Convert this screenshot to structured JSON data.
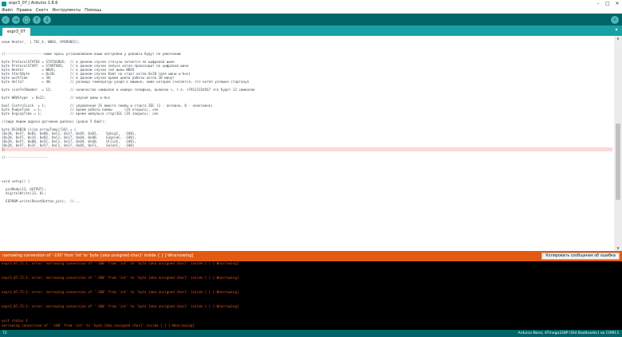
{
  "window": {
    "title": "espr3_07 | Arduino 1.8.6"
  },
  "menu": [
    "Файл",
    "Правка",
    "Скетч",
    "Инструменты",
    "Помощь"
  ],
  "toolbar": {
    "verify": "✓",
    "upload": "→",
    "new": "□",
    "open": "↑",
    "save": "↓",
    "serial": "⌕"
  },
  "tab": {
    "name": "espr3_07"
  },
  "code_lines": [
    "",
    "enum Heater_  | TDC_E, WBUS, HYDRONIC};",
    "",
    "",
    "//-------------------ниже здесь устанавливаем ваши настройки у девайса будут по умолчанию",
    "",
    "byte ProtocolSTATUS = STATUSBUS;  // в данном случае статусы читается по цифровой шине",
    "byte ProtocolSTART  = STARTBUS;   // в данном случае запуск котла происходит по цифровой шине",
    "byte Heater         = WBUS;       // в данном случае тип шины WBUS",
    "byte StartByte      = 0x20;       // в данном случае байт на старт котла 0x20 (для шины w-bus)",
    "byte workTime       = 30;         // в данном случае время цикла работы котла 30 минут",
    "byte delta?         = 40;         // разница температур уходя к машине, ниже которой считается, что котёл успешно стартанул",
    "",
    "byte sizeTelNumber  = 12;         // количество символов в номере телефона, включая +, т.е. +79123334567 это будет 12 символов",
    "",
    "byte WBUStype  = 0x22;            // версия шины w-bus",
    "",
    "bool ControlLock  = 1;            // управление ZS вместо помпы и старта ZБС (1 - активно, 0 - неактивно)",
    "byte PumpeTime  = 1;              // время работы помпы      (ZS открыть), сек",
    "byte EnginpTime = 1;              // время импульса старт2БС (ZS закрыть), сек",
    "",
    "//сюда пишем адреса датчиков далласс (ровно 5 байт):",
    "",
    "byte DS18B20 [size_arrayTemp][10] = {",
    "{0x28, 0xFF, 0xB2, 0xB6, 0xC1, 0x17, 0x05, 0xB1,    VybigC,  -100},",
    "{0x28, 0xFF, 0x35, 0xB2, 0xC1, 0x17, 0x04, 0x0D,    EngineC, -100},",
    "{0x28, 0xFF, 0x0B, 0x5C, 0xC1, 0x17, 0x04, 0x60,    UlicaC,  -100},",
    "{0x28, 0xFF, 0x3F, 0x57, 0xC1, 0x17, 0x05, 0xF1,    SalonC,  -100}",
    "};",
    "",
    "//---------------------",
    "",
    "",
    "",
    "",
    "",
    "void setup() {",
    "",
    "  pinMode(13, OUTPUT);",
    "  digitalWrite(13, 0);",
    "",
    "  EEPROM.write(ResetButton_pin);  //..."
  ],
  "status_message": "narrowing conversion of '-100' from 'int' to 'byte {aka unsigned char}' inside { } [-Wnarrowing]",
  "copy_button": "Копировать сообщения об ошибка",
  "console_lines": [
    "espr3_07:72:1: error: narrowing conversion of '-100' from 'int' to 'byte {aka unsigned char}' inside { } [-Wnarrowing]",
    "",
    "",
    "espr3_07:72:1: error: narrowing conversion of '-100' from 'int' to 'byte {aka unsigned char}' inside { } [-Wnarrowing]",
    "",
    "",
    "espr3_07:72:1: error: narrowing conversion of '-100' from 'int' to 'byte {aka unsigned char}' inside { } [-Wnarrowing]",
    "",
    "",
    "espr3_07:72:1: error: narrowing conversion of '-100' from 'int' to 'byte {aka unsigned char}' inside { } [-Wnarrowing]",
    "",
    "",
    "exit status 1",
    "narrowing conversion of '-100' from 'int' to 'byte {aka unsigned char}' inside { } [-Wnarrowing]"
  ],
  "footer": {
    "line_number": "72",
    "board": "Arduino Nano, ATmega328P (Old Bootloader) на COM13"
  }
}
